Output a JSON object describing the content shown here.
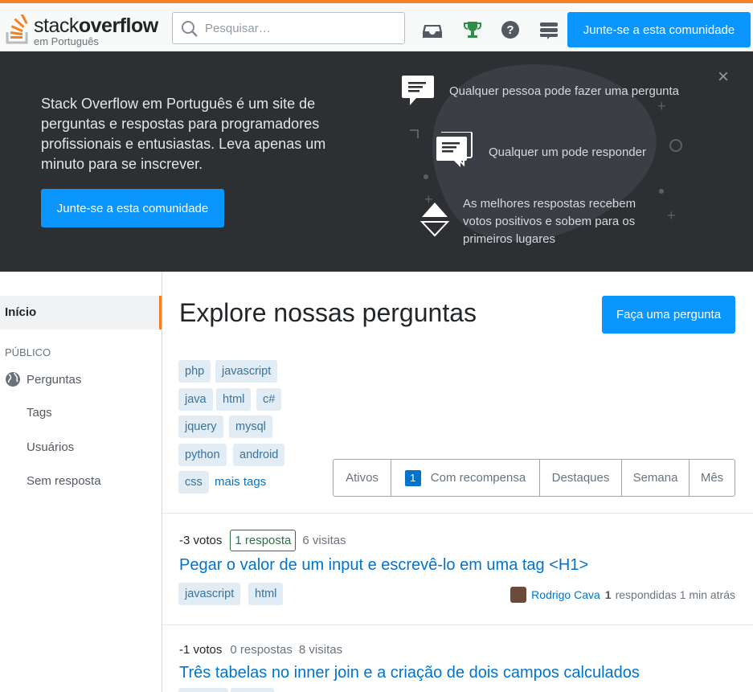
{
  "header": {
    "logo_word_light": "stack",
    "logo_word_bold": "overflow",
    "logo_sub": "em Português",
    "search_placeholder": "Pesquisar…",
    "join_label": "Junte-se a esta comunidade",
    "icons": [
      "inbox-icon",
      "achievements-icon",
      "help-icon",
      "site-switcher-icon"
    ]
  },
  "hero": {
    "description": "Stack Overflow em Português é um site de perguntas e respostas para programadores profissionais e entusiastas. Leva apenas um minuto para se inscrever.",
    "join_label": "Junte-se a esta comunidade",
    "close": "×",
    "features": [
      {
        "icon": "ask-bubble-icon",
        "text": "Qualquer pessoa pode fazer uma pergunta"
      },
      {
        "icon": "answer-bubble-icon",
        "text": "Qualquer um pode responder"
      },
      {
        "icon": "vote-arrows-icon",
        "text": "As melhores respostas recebem votos positivos e sobem para os primeiros lugares"
      }
    ]
  },
  "sidebar": {
    "home": "Início",
    "section": "PÚBLICO",
    "items": [
      {
        "label": "Perguntas",
        "icon": "globe-icon"
      },
      {
        "label": "Tags"
      },
      {
        "label": "Usuários"
      },
      {
        "label": "Sem resposta"
      }
    ]
  },
  "main": {
    "title": "Explore nossas perguntas",
    "ask_label": "Faça uma pergunta",
    "tags": [
      "php",
      "javascript",
      "java",
      "html",
      "c#",
      "jquery",
      "mysql",
      "python",
      "android",
      "css"
    ],
    "more_tags": "mais tags",
    "filters": [
      {
        "label": "Ativos"
      },
      {
        "label": "Com recompensa",
        "badge": "1"
      },
      {
        "label": "Destaques"
      },
      {
        "label": "Semana"
      },
      {
        "label": "Mês"
      }
    ]
  },
  "questions": [
    {
      "votes": "-3 votos",
      "answers": "1 resposta",
      "views": "6 visitas",
      "title": "Pegar o valor de um input e escrevê-lo em uma tag <H1>",
      "tags": [
        "javascript",
        "html"
      ],
      "user": "Rodrigo Cava",
      "rep": "1",
      "when": "respondidas 1 min atrás"
    },
    {
      "votes": "-1 votos",
      "answers": "0 respostas",
      "views": "8 visitas",
      "title": "Três tabelas no inner join e a criação de dois campos calculados"
    }
  ],
  "colors": {
    "accent": "#f48024",
    "primary_button": "#0a95ff",
    "link": "#0074cc",
    "tag_bg": "#e1ecf4",
    "hero_bg": "#2d2f33"
  }
}
